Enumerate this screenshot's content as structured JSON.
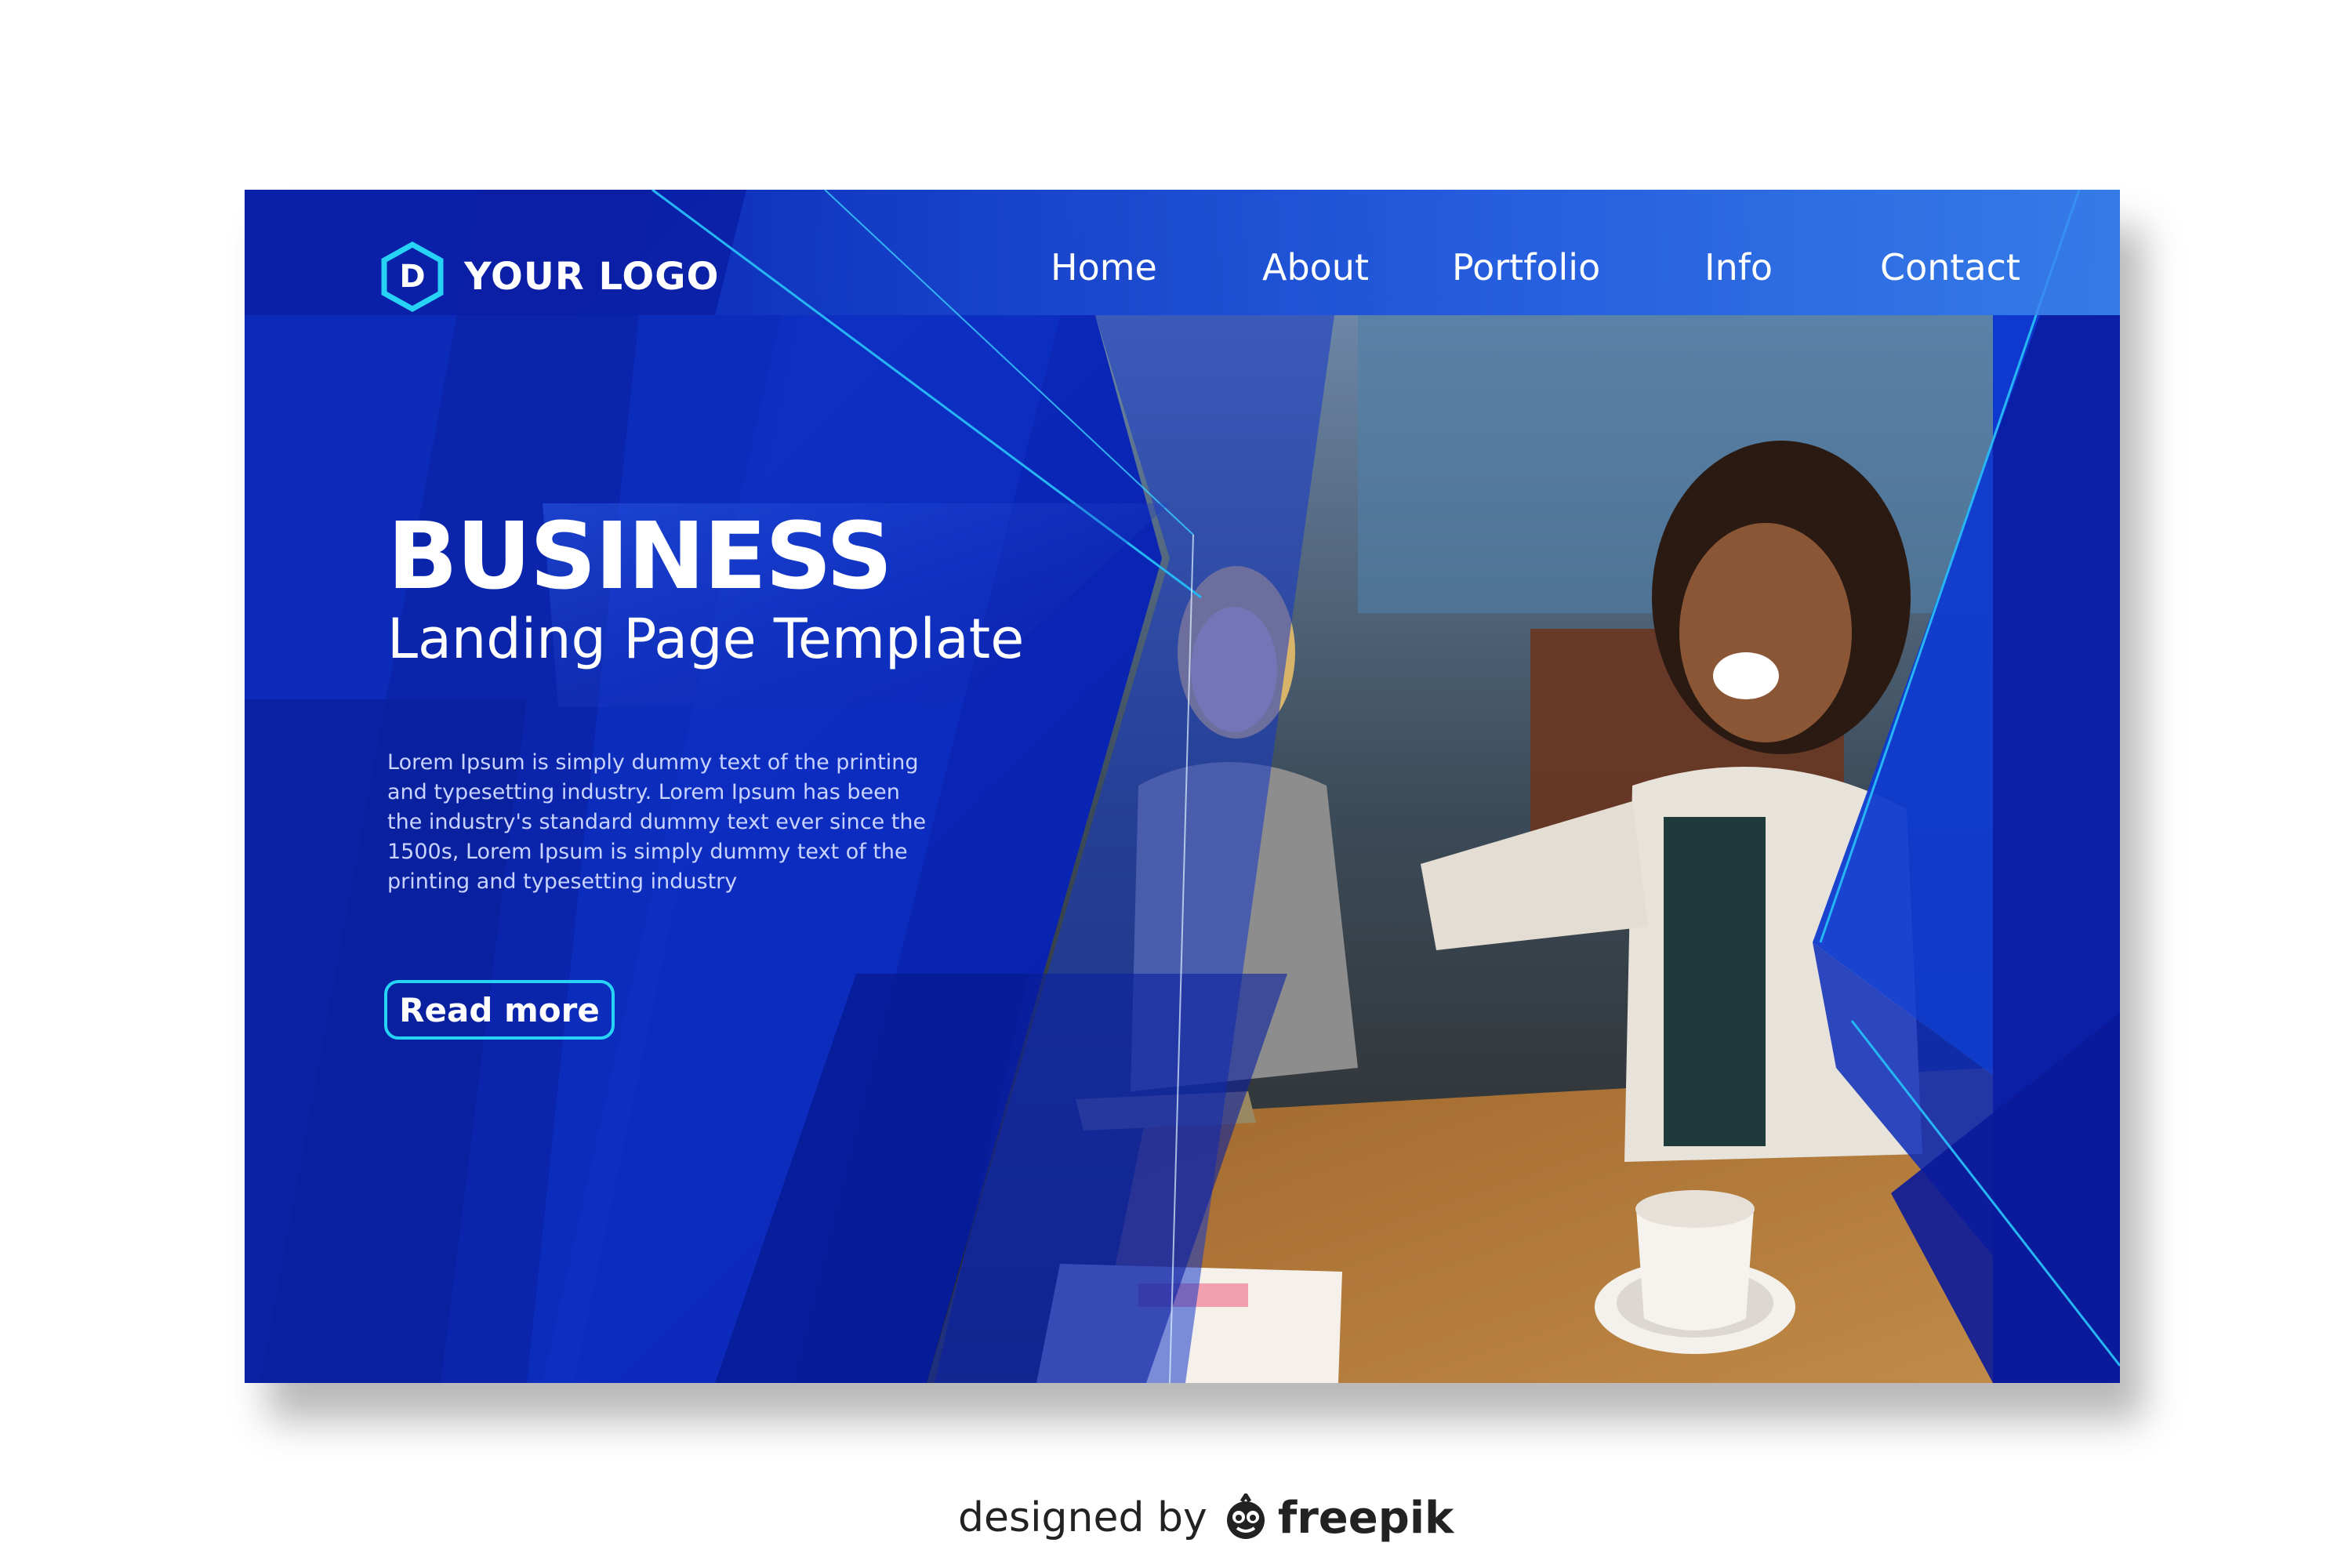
{
  "colors": {
    "page_background": "#ffffff",
    "card_blue_dark": "#071b9e",
    "card_blue_mid": "#0a26b6",
    "card_blue_light": "#1c6fe0",
    "accent_cyan": "#27d3f5",
    "body_text": "#c9d3ff"
  },
  "logo": {
    "icon": "hexagon-icon",
    "letter": "D",
    "text": "YOUR LOGO"
  },
  "nav": {
    "items": [
      {
        "label": "Home"
      },
      {
        "label": "About"
      },
      {
        "label": "Portfolio"
      },
      {
        "label": "Info"
      },
      {
        "label": "Contact"
      }
    ]
  },
  "hero": {
    "title": "BUSINESS",
    "subtitle": "Landing Page Template",
    "body": "Lorem Ipsum is simply dummy text of the printing and typesetting industry. Lorem Ipsum has been the industry's standard dummy text ever since the 1500s, Lorem Ipsum is simply dummy text of the printing and typesetting industry",
    "button_label": "Read more"
  },
  "photo": {
    "icon": "business-photo"
  },
  "credit": {
    "prefix": "designed by",
    "icon": "freepik-mascot-icon",
    "brand": "freepik"
  }
}
